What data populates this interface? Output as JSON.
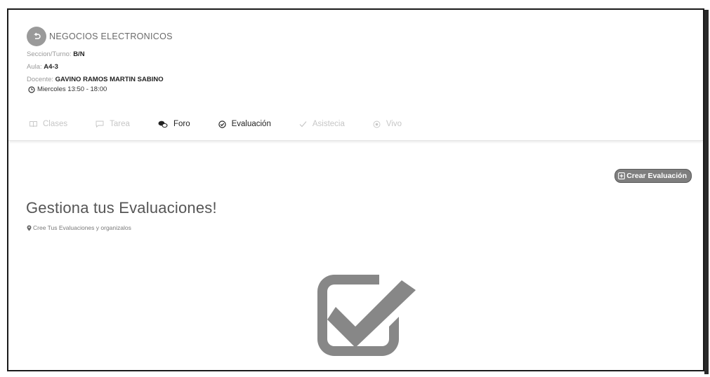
{
  "course": {
    "title": "NEGOCIOS ELECTRONICOS",
    "seccion_label": "Seccion/Turno:",
    "seccion_value": "B/N",
    "aula_label": "Aula:",
    "aula_value": "A4-3",
    "docente_label": "Docente:",
    "docente_value": "GAVINO RAMOS MARTIN SABINO",
    "schedule": "Miercoles 13:50 - 18:00"
  },
  "tabs": [
    {
      "label": "Clases",
      "icon": "book-icon",
      "enabled": false
    },
    {
      "label": "Tarea",
      "icon": "chat-bubble-icon",
      "enabled": false
    },
    {
      "label": "Foro",
      "icon": "comments-icon",
      "enabled": true
    },
    {
      "label": "Evaluación",
      "icon": "check-circle-icon",
      "enabled": true
    },
    {
      "label": "Asistecia",
      "icon": "checkmark-icon",
      "enabled": false
    },
    {
      "label": "Vivo",
      "icon": "record-icon",
      "enabled": false
    }
  ],
  "actions": {
    "create_label": "Crear Evaluación"
  },
  "main": {
    "title": "Gestiona tus Evaluaciones!",
    "subtitle": "Cree Tus Evaluaciones y organizalos"
  },
  "colors": {
    "button_bg": "#7e7e7e",
    "icon_gray": "#8a8a8a",
    "disabled_text": "#c6c6c6"
  }
}
